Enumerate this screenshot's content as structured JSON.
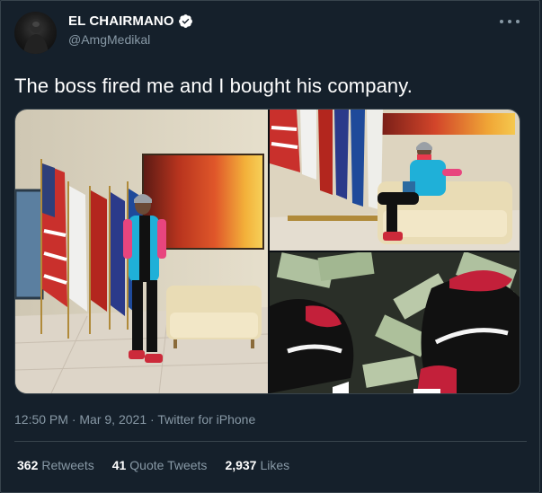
{
  "author": {
    "display_name": "EL CHAIRMANO",
    "handle": "@AmgMedikal",
    "verified": true,
    "avatar_icon": "avatar-photo"
  },
  "tweet": {
    "text": "The boss fired me and I bought his company.",
    "media": [
      {
        "name": "photo-man-standing-lobby"
      },
      {
        "name": "photo-man-sitting-couch"
      },
      {
        "name": "photo-sneakers-money"
      }
    ]
  },
  "meta": {
    "time": "12:50 PM",
    "separator": " · ",
    "date": "Mar 9, 2021",
    "source": "Twitter for iPhone"
  },
  "stats": {
    "retweets_count": "362",
    "retweets_label": "Retweets",
    "quotes_count": "41",
    "quotes_label": "Quote Tweets",
    "likes_count": "2,937",
    "likes_label": "Likes"
  },
  "colors": {
    "background": "#15202b",
    "border": "#38444d",
    "secondary_text": "#8899a6",
    "verified_blue": "#ffffff"
  }
}
